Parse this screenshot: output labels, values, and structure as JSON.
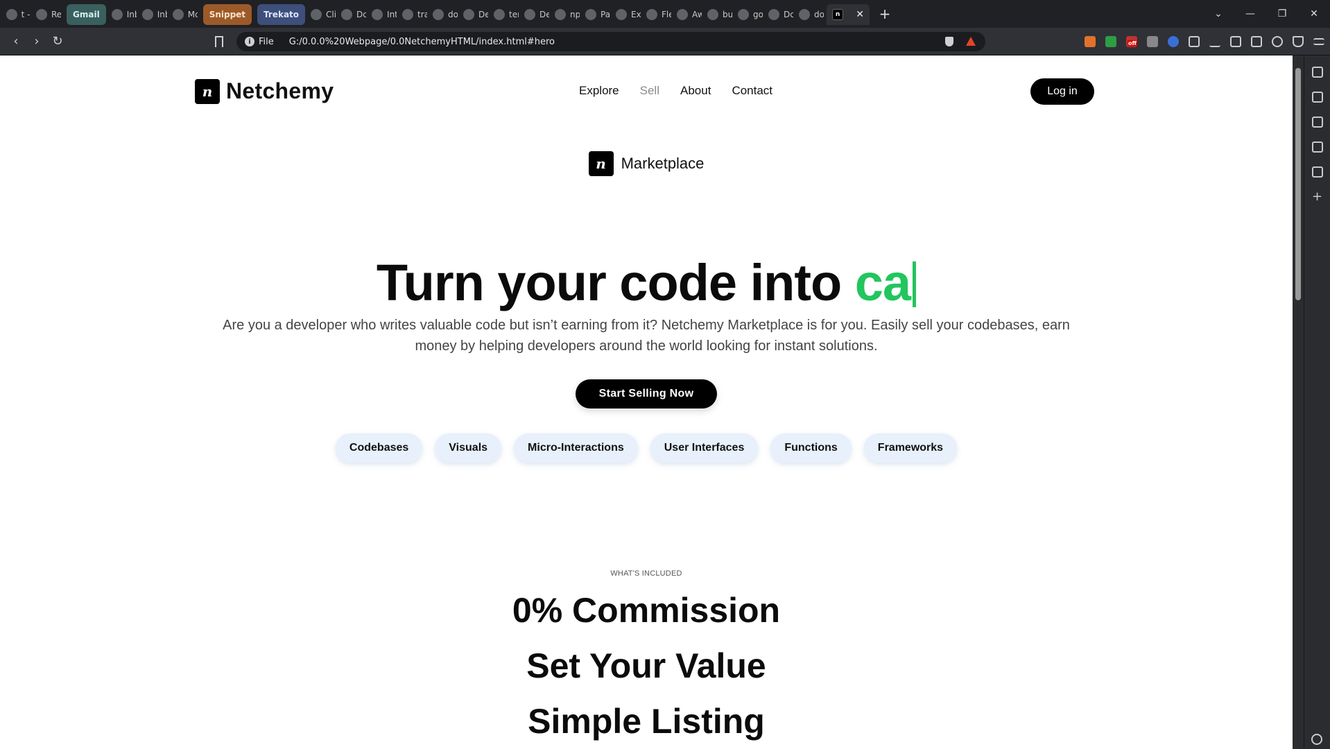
{
  "browser": {
    "tabs": [
      {
        "label": "t -",
        "type": "normal"
      },
      {
        "label": "Re",
        "type": "normal"
      },
      {
        "label": "Gmail",
        "type": "gmail"
      },
      {
        "label": "Inb",
        "type": "normal"
      },
      {
        "label": "Inb",
        "type": "normal"
      },
      {
        "label": "Mc",
        "type": "normal"
      },
      {
        "label": "Snippet",
        "type": "snippet"
      },
      {
        "label": "Trekato",
        "type": "trekato"
      },
      {
        "label": "Cli",
        "type": "normal"
      },
      {
        "label": "Dc",
        "type": "normal"
      },
      {
        "label": "Int",
        "type": "normal"
      },
      {
        "label": "tra",
        "type": "normal"
      },
      {
        "label": "do",
        "type": "normal"
      },
      {
        "label": "De",
        "type": "normal"
      },
      {
        "label": "ter",
        "type": "normal"
      },
      {
        "label": "De",
        "type": "normal"
      },
      {
        "label": "np",
        "type": "normal"
      },
      {
        "label": "Pay",
        "type": "normal"
      },
      {
        "label": "Exc",
        "type": "normal"
      },
      {
        "label": "Fle",
        "type": "normal"
      },
      {
        "label": "Aw",
        "type": "normal"
      },
      {
        "label": "bui",
        "type": "normal"
      },
      {
        "label": "go",
        "type": "normal"
      },
      {
        "label": "Dc",
        "type": "normal"
      },
      {
        "label": "do",
        "type": "normal"
      }
    ],
    "active_tab_icon": "n",
    "new_tab": "+",
    "address": {
      "scheme_label": "File",
      "url": "G:/0.0.0%20Webpage/0.0NetchemyHTML/index.html#hero"
    },
    "extension_icons": [
      "puzzle-icon",
      "download-icon",
      "sidebar-icon",
      "wallet-icon",
      "sparkle-icon",
      "shield-icon",
      "menu-icon"
    ],
    "extension_badge": "off"
  },
  "nav": {
    "brand": "Netchemy",
    "logo_glyph": "n",
    "links": [
      {
        "label": "Explore",
        "state": "normal"
      },
      {
        "label": "Sell",
        "state": "muted"
      },
      {
        "label": "About",
        "state": "normal"
      },
      {
        "label": "Contact",
        "state": "normal"
      }
    ],
    "login_label": "Log in"
  },
  "marketplace": {
    "logo_glyph": "n",
    "label": "Marketplace"
  },
  "hero": {
    "title_prefix": "Turn your code into ",
    "title_typed": "ca",
    "accent_color": "#22c55e",
    "subtitle": "Are you a developer who writes valuable code but isn’t earning from it? Netchemy Marketplace is for you. Easily sell your codebases, earn money by helping developers around the world looking for instant solutions.",
    "cta_label": "Start Selling Now"
  },
  "categories": [
    "Codebases",
    "Visuals",
    "Micro-Interactions",
    "User Interfaces",
    "Functions",
    "Frameworks"
  ],
  "included": {
    "eyebrow": "WHAT'S INCLUDED",
    "features": [
      "0% Commission",
      "Set Your Value",
      "Simple Listing"
    ]
  }
}
